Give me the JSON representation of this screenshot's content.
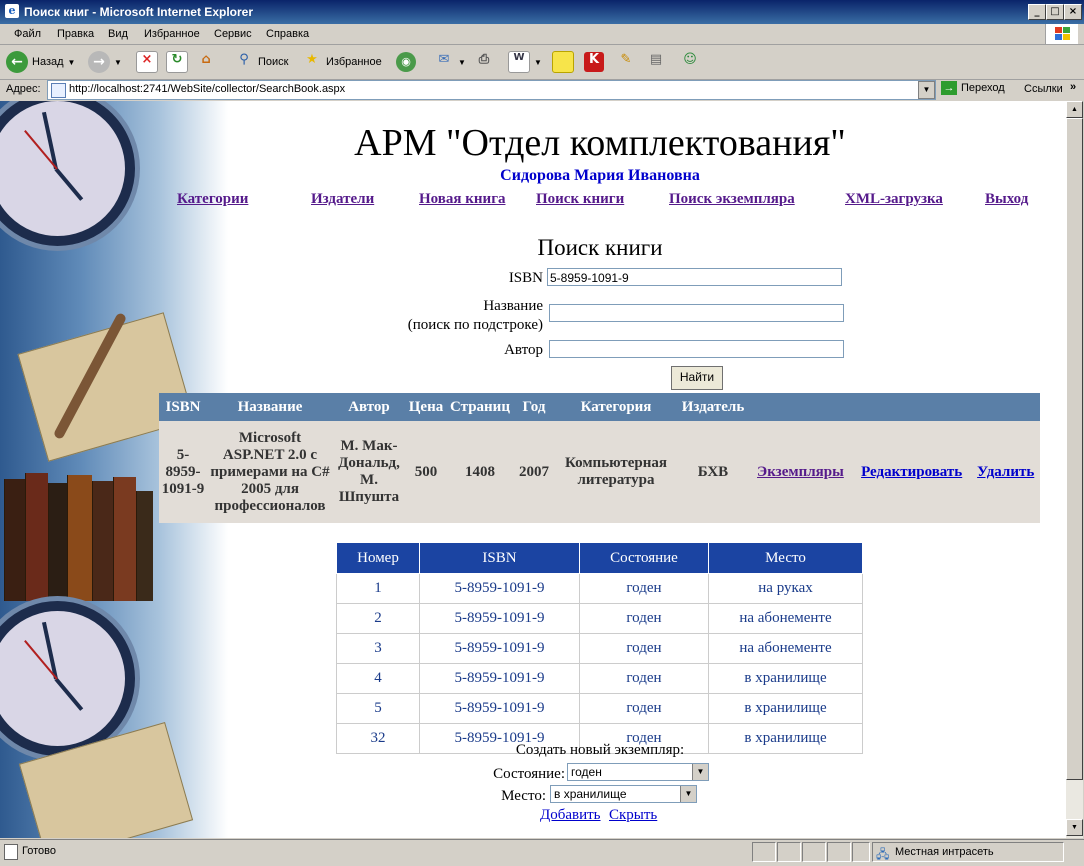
{
  "window": {
    "title": "Поиск книг - Microsoft Internet Explorer"
  },
  "menu": [
    "Файл",
    "Правка",
    "Вид",
    "Избранное",
    "Сервис",
    "Справка"
  ],
  "toolbar": {
    "back": "Назад",
    "search": "Поиск",
    "favorites": "Избранное"
  },
  "address": {
    "label": "Адрес:",
    "url": "http://localhost:2741/WebSite/collector/SearchBook.aspx",
    "go": "Переход",
    "links": "Ссылки"
  },
  "page": {
    "title": "АРМ \"Отдел комплектования\"",
    "user": "Сидорова Мария Ивановна",
    "nav": [
      "Категории",
      "Издатели",
      "Новая книга",
      "Поиск книги",
      "Поиск экземпляра",
      "XML-загрузка",
      "Выход"
    ],
    "search": {
      "heading": "Поиск книги",
      "isbn_label": "ISBN",
      "isbn_value": "5-8959-1091-9",
      "name_label": "Название",
      "name_hint": "(поиск по подстроке)",
      "author_label": "Автор",
      "button": "Найти"
    },
    "books": {
      "headers": [
        "ISBN",
        "Название",
        "Автор",
        "Цена",
        "Страниц",
        "Год",
        "Категория",
        "Издатель"
      ],
      "row": {
        "isbn": "5-8959-1091-9",
        "name": "Microsoft ASP.NET 2.0 с примерами на C# 2005 для профессионалов",
        "author": "М. Мак-Дональд, М. Шпушта",
        "price": "500",
        "pages": "1408",
        "year": "2007",
        "category": "Компьютерная литература",
        "publisher": "БХВ",
        "copies_link": "Экземпляры",
        "edit_link": "Редактировать",
        "delete_link": "Удалить"
      }
    },
    "copies": {
      "headers": [
        "Номер",
        "ISBN",
        "Состояние",
        "Место"
      ],
      "rows": [
        [
          "1",
          "5-8959-1091-9",
          "годен",
          "на руках"
        ],
        [
          "2",
          "5-8959-1091-9",
          "годен",
          "на абонементе"
        ],
        [
          "3",
          "5-8959-1091-9",
          "годен",
          "на абонементе"
        ],
        [
          "4",
          "5-8959-1091-9",
          "годен",
          "в хранилище"
        ],
        [
          "5",
          "5-8959-1091-9",
          "годен",
          "в хранилище"
        ],
        [
          "32",
          "5-8959-1091-9",
          "годен",
          "в хранилище"
        ]
      ]
    },
    "new_copy": {
      "heading": "Создать новый экземпляр:",
      "state_label": "Состояние:",
      "state_value": "годен",
      "place_label": "Место:",
      "place_value": "в хранилище",
      "add_link": "Добавить",
      "hide_link": "Скрыть"
    }
  },
  "status": {
    "text": "Готово",
    "zone": "Местная интрасеть"
  }
}
